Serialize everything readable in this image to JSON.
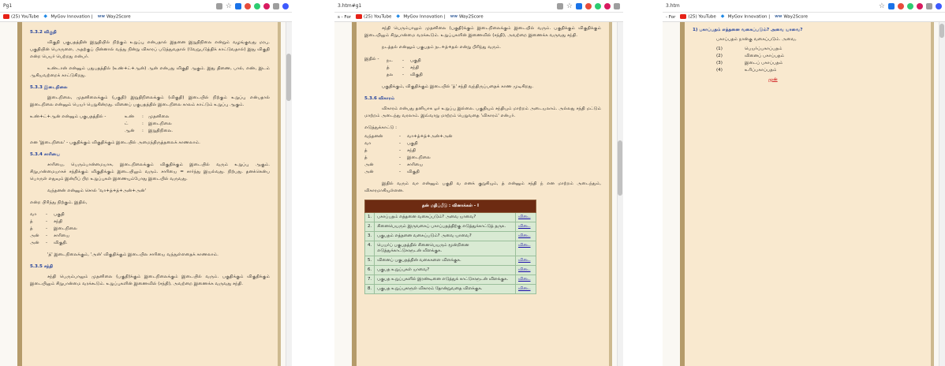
{
  "bookmarks": {
    "youtube": "(25) YouTube",
    "mygov": "MyGov Innovation |",
    "way2score": "Way2Score",
    "prefix2": "s - For",
    "prefix3": "- For"
  },
  "windows": [
    {
      "url": "Pg1"
    },
    {
      "url": "3.htm#g1"
    },
    {
      "url": "3.htm"
    }
  ],
  "w1": {
    "h1": "5.3.2 விகுதி",
    "p1": "விகுதி பகுபதத்தின் இறுதியில் நிற்கும் உறுப்பு என்பதால் இதனை இறுதிநிலை என்றும் வழங்குவது மரபு. பகுதியின் பொருளை, அதற்குப் பின்னால் வந்து நின்று விகாரப் படுத்துவதால் (வேறுபடுத்திக் காட்டுவதால்) இது விகுதி என்ற பெயர் பெற்றது என்பர்.",
    "p2": "உண்டான் என்னும் பதுபதத்தில் (உண்+ட்+ஆன்) ஆன் என்பது விகுதி ஆகும். இது திணை, பால், எண், இடம் ஆகியவற்றைக் காட்டுகிறது.",
    "h2": "5.3.3 இடைநிலை",
    "p3": "இடைநிலை, முதனிலைக்கும் (பகுதி) இறுதிநிலைக்கும் (விகுதி) இடையில் நிற்கும் உறுப்பு என்பதால் இடைநிலை என்னும் பெயர் பெறுகின்றது. வினைப் பகுபதத்தில் இடைநிலை காலம் காட்டும் உறுப்பு ஆகும்.",
    "ex_label": "உண்+ட்+ஆன் என்னும் பகுபதத்தில் -",
    "ex": [
      {
        "k": "உண்",
        "v": "முதனிலை"
      },
      {
        "k": "ட்",
        "v": "இடைநிலை"
      },
      {
        "k": "ஆன்",
        "v": "இறுதிநிலை."
      }
    ],
    "p4": "என 'இடைநிலை' - பகுதிக்கும் விகுதிக்கும் இடையில் அமைந்திருத்தலைக் காணலாம்.",
    "h3": "5.3.4 சாரியை",
    "p5": "சாரியை, பெரும்பான்மையாக, இடைநிலைக்கும் விகுதிக்கும் இடையில் வரும் உறுப்பு ஆகும். சிறுபான்மையாகச் சந்திக்கும் விகுதிக்கும் இடையிலும் வரும். சாரியை = சார்ந்து இயல்வது. நிற்பது. தனக்கென்ப பொருள் எதுவும் இன்றிப் பிற உறுப்புகள் இணையும்போது இடையில் வருவது.",
    "p6": "வந்தனன் என்னும் சொல் 'வா+த்+த்+அன்+அன்'",
    "p7": "என்ற பிரிந்து நிற்கும். இதில்,",
    "parts": [
      {
        "k": "வா",
        "v": "பகுதி"
      },
      {
        "k": "த்",
        "v": "சந்தி"
      },
      {
        "k": "த்",
        "v": "இடைநிலை"
      },
      {
        "k": "அன்",
        "v": "சாரியை"
      },
      {
        "k": "அன்",
        "v": "விகுதி."
      }
    ],
    "p8": "'த்' இடைநிலைக்கும், 'அன்' விகுதிக்கும் இடையில சாரியை வந்துள்ளதைக் காணலாம்.",
    "h4": "5.3.5 சந்தி",
    "p9": "சந்தி பெரும்பாலும் முதனிலை (பகுதி)க்கும் இடைநிலைக்கும் இடையில் வரும். பகுதிக்கும் விகுதிக்கும் இடையிலும் சிறுபான்மை வரக்கூடும். உறுப்புகளின் இணைவில் (சந்தி), அவற்றை இணைக்க வருவது சந்தி."
  },
  "w2": {
    "p1": "சந்தி பெரும்பாலும் முதனிலை (பகுதி)க்கும் இடைநிலைக்கும் இடையில் வரும். பகுதிக்கும் விகுதிக்கும் இடையிலும் சிறுபான்மை வரக்கூடும். உறுப்புகளின் இணைவில் (சந்தி), அவற்றை இணைக்க வருவது சந்தி.",
    "p2": "நடத்தல் என்னும் பகுபதம் நட+த்+தல் என்று பிரிந்து வரும்.",
    "ithil": "இதில் -",
    "parts": [
      {
        "k": "நட",
        "v": "பகுதி"
      },
      {
        "k": "த்",
        "v": "சந்தி"
      },
      {
        "k": "தல",
        "v": "விகுதி"
      }
    ],
    "p3": "பகுதிக்கும், விகுதிக்கும் இடையில் 'த்' சந்தி வந்திருப்பதைக் காண முடிகிறது.",
    "h1": "5.3.6 விகாரம்",
    "p4": "விகாரம் என்பது தனியாக ஓர் உறுப்பு இல்லை. பகுதியும் சந்தியும் மாற்றம் அடையலாம். அல்லது சந்தி மட்டும் மாற்றம் அடைந்து வரலாம். இவ்வாறு மாற்றம் பெறுவதை 'விகாரம்' என்பர்.",
    "ex_title": "எடுத்துக்காட்டு :",
    "ex": [
      {
        "k": "வந்தனன்",
        "v": "வா+த்+த்+அன்+அன்"
      },
      {
        "k": "வா",
        "v": "பகுதி"
      },
      {
        "k": "த்",
        "v": "சந்தி"
      },
      {
        "k": "த்",
        "v": "இடைநிலை"
      },
      {
        "k": "அன்",
        "v": "சாரியை"
      },
      {
        "k": "அன்",
        "v": "விகுதி"
      }
    ],
    "p5": "இதில் வரும் வா என்னும் பகுதி வ எனக் குறுகியும், த் என்னும் சந்தி ந் என மாற்றம் அடைந்தும், விகாரமாகியுள்ளன.",
    "quiz_title": "தன் மதிப்பீடு : வினாக்கள் - I",
    "quiz_answer": "விடை",
    "quiz": [
      {
        "n": "1.",
        "q": "பகாப்பதம் எத்தனை வகைப்படும்? அவை யாவை?"
      },
      {
        "n": "2.",
        "q": "சினைபெயரும் இருவகைப் பகாப்பதத்திற்கு எடுத்துக்காட்டுத் தருக."
      },
      {
        "n": "3.",
        "q": "பகுபதம் எத்தனை வகைப்படும்? அவை யாவை?"
      },
      {
        "n": "4.",
        "q": "பெயர்ப் பகுபதத்தில் சினைபெயரும் மூன்றினை எடுத்துக்காட்டுகளுடன் விளக்குக."
      },
      {
        "n": "5.",
        "q": "வினைப் பகுபதத்தின் வகைகளை விளக்குக."
      },
      {
        "n": "6.",
        "q": "பகுபத உறுப்புகள் யாவை?"
      },
      {
        "n": "7.",
        "q": "பகுபத உறுப்புகளில் இரண்டினை எடுத்துக் காட்டுகளுடன் விளக்குக."
      },
      {
        "n": "8.",
        "q": "பகுபத உறுப்புகளுள் விகாரம் தோன்றுவதை விளக்குக."
      }
    ]
  },
  "w3": {
    "question": "1)   பகாப்பதம் எத்தனை வகைப்படும்? அவை யாவை?",
    "lead": "பகாப்பதம் நான்கு வகைப்படும். அவை,",
    "opts": [
      {
        "n": "(1)",
        "t": "பெயர்ப்பகாப்பதம்"
      },
      {
        "n": "(2)",
        "t": "வினைப் பகாப்பதம்"
      },
      {
        "n": "(3)",
        "t": "இடைப் பகாப்பதம்"
      },
      {
        "n": "(4)",
        "t": "உரிப்பகாப்பதம்"
      }
    ],
    "back": "முன்"
  }
}
